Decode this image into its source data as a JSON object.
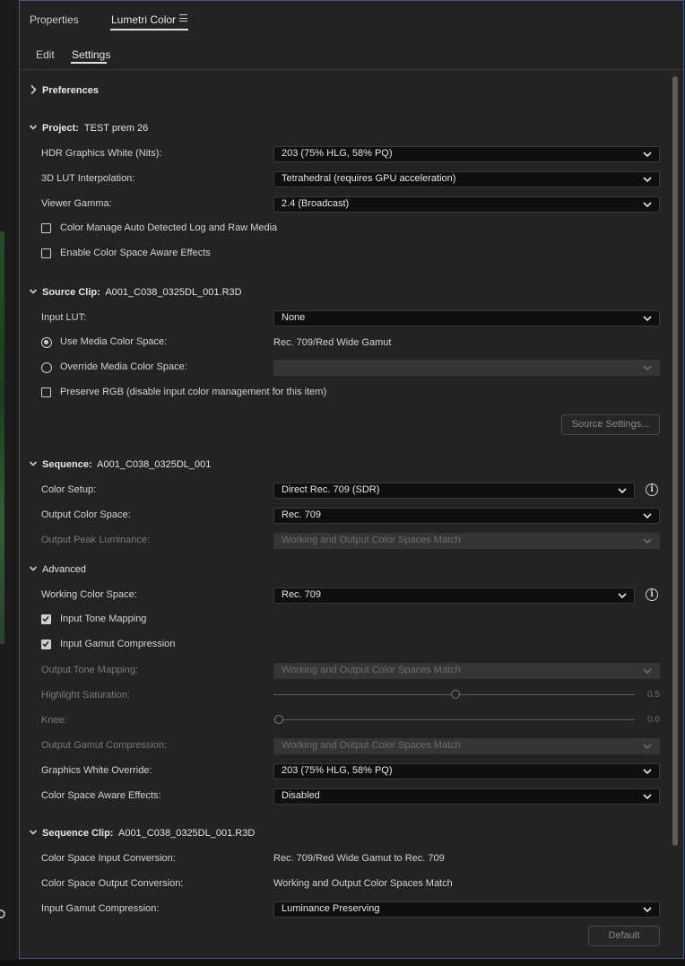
{
  "tabs": {
    "properties": "Properties",
    "lumetri": "Lumetri Color"
  },
  "subtabs": {
    "edit": "Edit",
    "settings": "Settings"
  },
  "preferences": {
    "title": "Preferences"
  },
  "project": {
    "title": "Project:",
    "name": "TEST prem 26",
    "hdr_white_label": "HDR Graphics White (Nits):",
    "hdr_white_value": "203 (75% HLG, 58% PQ)",
    "lut_interp_label": "3D LUT Interpolation:",
    "lut_interp_value": "Tetrahedral (requires GPU acceleration)",
    "viewer_gamma_label": "Viewer Gamma:",
    "viewer_gamma_value": "2.4 (Broadcast)",
    "color_manage_label": "Color Manage Auto Detected Log and Raw Media",
    "color_manage_checked": false,
    "cs_aware_label": "Enable Color Space Aware Effects",
    "cs_aware_checked": false
  },
  "source_clip": {
    "title": "Source Clip:",
    "name": "A001_C038_0325DL_001.R3D",
    "input_lut_label": "Input LUT:",
    "input_lut_value": "None",
    "use_media_label": "Use Media Color Space:",
    "use_media_value": "Rec. 709/Red Wide Gamut",
    "override_label": "Override Media Color Space:",
    "override_value": "",
    "preserve_rgb_label": "Preserve RGB (disable input color management for this item)",
    "preserve_rgb_checked": false,
    "source_settings_button": "Source Settings..."
  },
  "sequence": {
    "title": "Sequence:",
    "name": "A001_C038_0325DL_001",
    "color_setup_label": "Color Setup:",
    "color_setup_value": "Direct Rec. 709 (SDR)",
    "output_cs_label": "Output Color Space:",
    "output_cs_value": "Rec. 709",
    "peak_lum_label": "Output Peak Luminance:",
    "peak_lum_value": "Working and Output Color Spaces Match"
  },
  "advanced": {
    "title": "Advanced",
    "working_cs_label": "Working Color Space:",
    "working_cs_value": "Rec. 709",
    "input_tone_label": "Input Tone Mapping",
    "input_tone_checked": true,
    "input_gamut_label": "Input Gamut Compression",
    "input_gamut_checked": true,
    "output_tone_label": "Output Tone Mapping:",
    "output_tone_value": "Working and Output Color Spaces Match",
    "highlight_sat_label": "Highlight Saturation:",
    "highlight_sat_value": "0.5",
    "knee_label": "Knee:",
    "knee_value": "0.0",
    "output_gamut_label": "Output Gamut Compression:",
    "output_gamut_value": "Working and Output Color Spaces Match",
    "gfx_white_label": "Graphics White Override:",
    "gfx_white_value": "203 (75% HLG, 58% PQ)",
    "cs_aware_effects_label": "Color Space Aware Effects:",
    "cs_aware_effects_value": "Disabled"
  },
  "sequence_clip": {
    "title": "Sequence Clip:",
    "name": "A001_C038_0325DL_001.R3D",
    "input_conv_label": "Color Space Input Conversion:",
    "input_conv_value": "Rec. 709/Red Wide Gamut to Rec. 709",
    "output_conv_label": "Color Space Output Conversion:",
    "output_conv_value": "Working and Output Color Spaces Match",
    "input_gamut_label": "Input Gamut Compression:",
    "input_gamut_value": "Luminance Preserving",
    "default_button": "Default"
  },
  "icons": {
    "chevron_right": "chevron-right-icon",
    "chevron_down": "chevron-down-icon",
    "info": "info-icon",
    "menu": "menu-icon"
  },
  "colors": {
    "panel_bg": "#232323",
    "dropdown_bg": "#0f0f0f",
    "focus_border": "#3d5a8a"
  }
}
